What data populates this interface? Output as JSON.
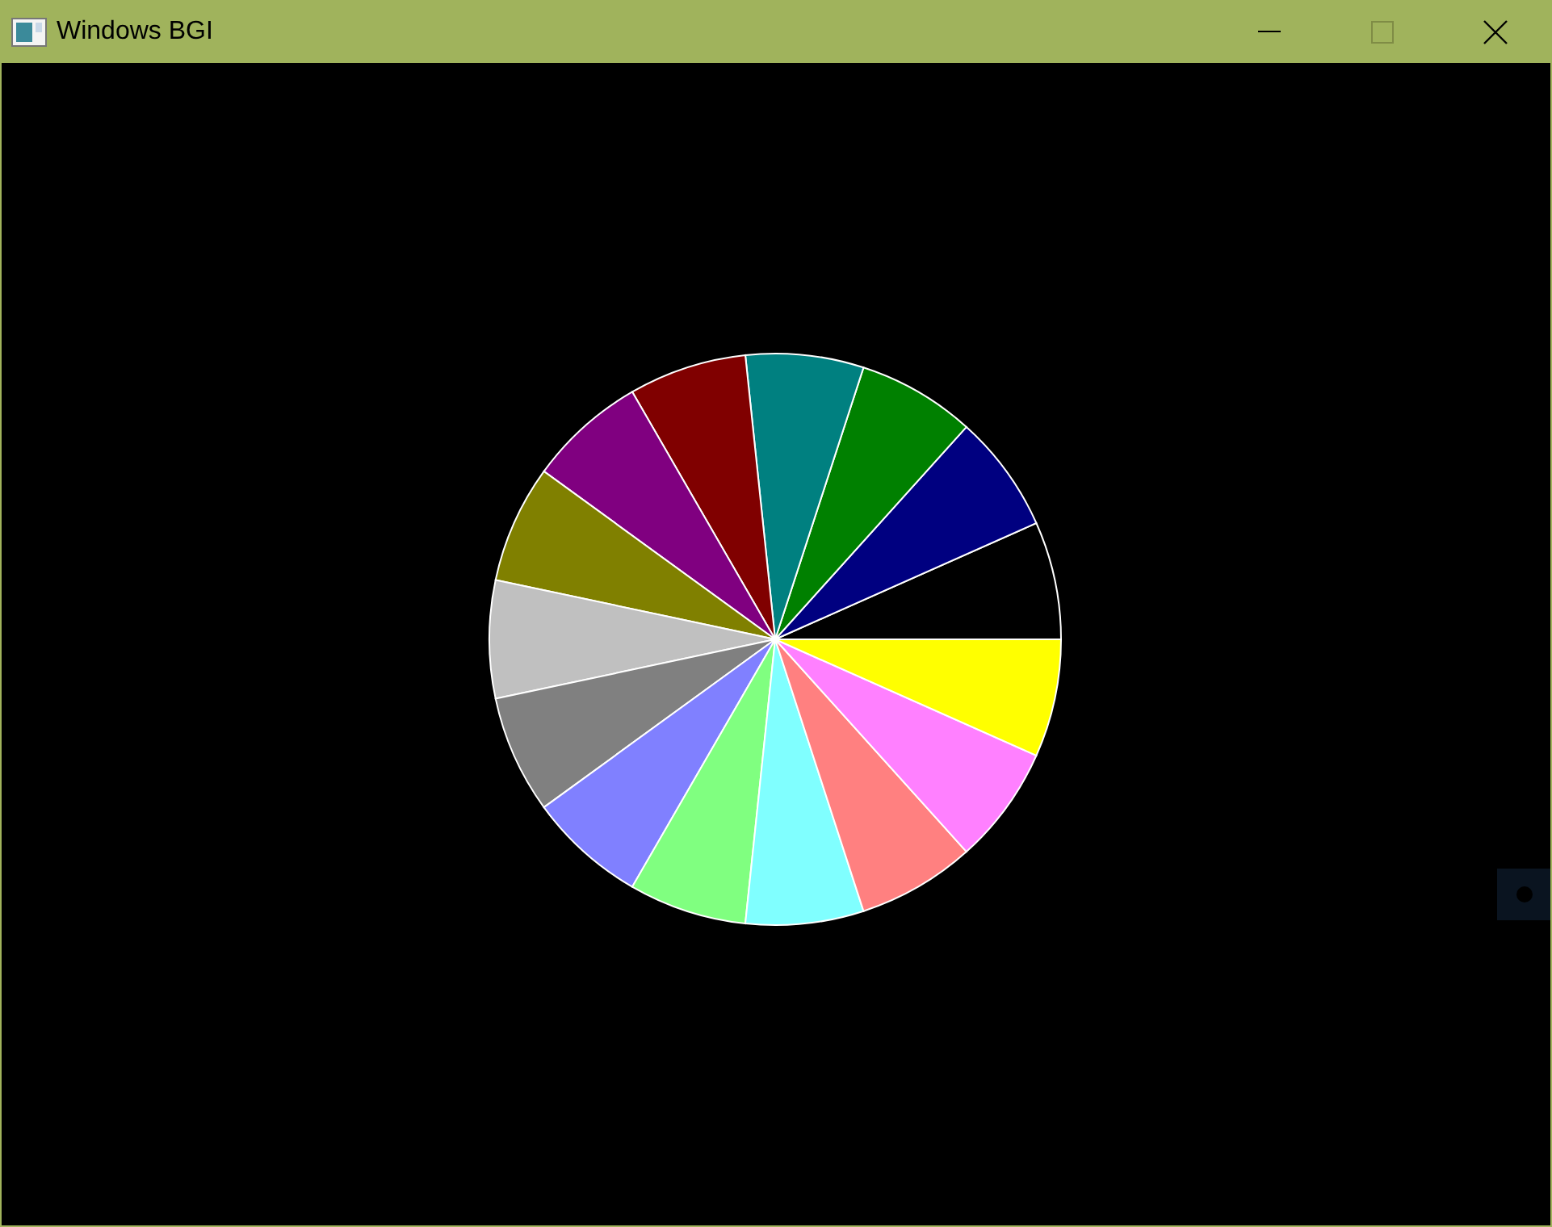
{
  "window": {
    "title": "Windows BGI",
    "maximize_disabled": true
  },
  "pie": {
    "slices": [
      {
        "color": "#000000"
      },
      {
        "color": "#000080"
      },
      {
        "color": "#008000"
      },
      {
        "color": "#008080"
      },
      {
        "color": "#800000"
      },
      {
        "color": "#800080"
      },
      {
        "color": "#808000"
      },
      {
        "color": "#c0c0c0"
      },
      {
        "color": "#808080"
      },
      {
        "color": "#8080ff"
      },
      {
        "color": "#80ff80"
      },
      {
        "color": "#80ffff"
      },
      {
        "color": "#ff8080"
      },
      {
        "color": "#ff80ff"
      },
      {
        "color": "#ffff00"
      }
    ]
  }
}
